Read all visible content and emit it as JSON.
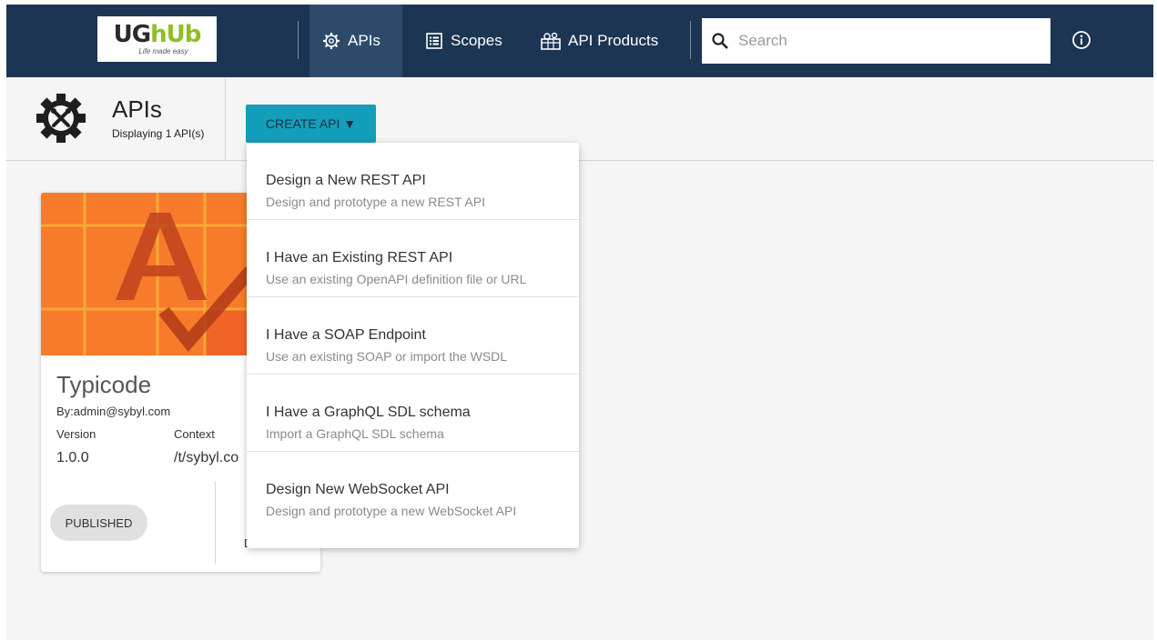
{
  "brand": {
    "logo_main_left": "UG",
    "logo_main_right": "hUb",
    "logo_tagline": "Life made easy"
  },
  "nav": {
    "items": [
      {
        "label": "APIs",
        "icon": "gear-icon",
        "active": true
      },
      {
        "label": "Scopes",
        "icon": "list-icon",
        "active": false
      },
      {
        "label": "API Products",
        "icon": "api-products-icon",
        "active": false
      }
    ],
    "search_placeholder": "Search",
    "search_value": ""
  },
  "subheader": {
    "title": "APIs",
    "count_text": "Displaying 1 API(s)",
    "create_button_label": "CREATE API ▼"
  },
  "create_menu": [
    {
      "title": "Design a New REST API",
      "description": "Design and prototype a new REST API"
    },
    {
      "title": "I Have an Existing REST API",
      "description": "Use an existing OpenAPI definition file or URL"
    },
    {
      "title": "I Have a SOAP Endpoint",
      "description": "Use an existing SOAP or import the WSDL"
    },
    {
      "title": "I Have a GraphQL SDL schema",
      "description": "Import a GraphQL SDL schema"
    },
    {
      "title": "Design New WebSocket API",
      "description": "Design and prototype a new WebSocket API"
    }
  ],
  "api_card": {
    "name": "Typicode",
    "owner": "By:admin@sybyl.com",
    "version_label": "Version",
    "version_value": "1.0.0",
    "context_label": "Context",
    "context_value": "/t/sybyl.co",
    "status": "PUBLISHED",
    "truncated_text": "D"
  },
  "colors": {
    "navbar": "#1c3553",
    "nav_active": "#2d4a6a",
    "create_button": "#139eba",
    "thumbnail": "#f77b2a",
    "logo_green": "#8dbf22"
  }
}
